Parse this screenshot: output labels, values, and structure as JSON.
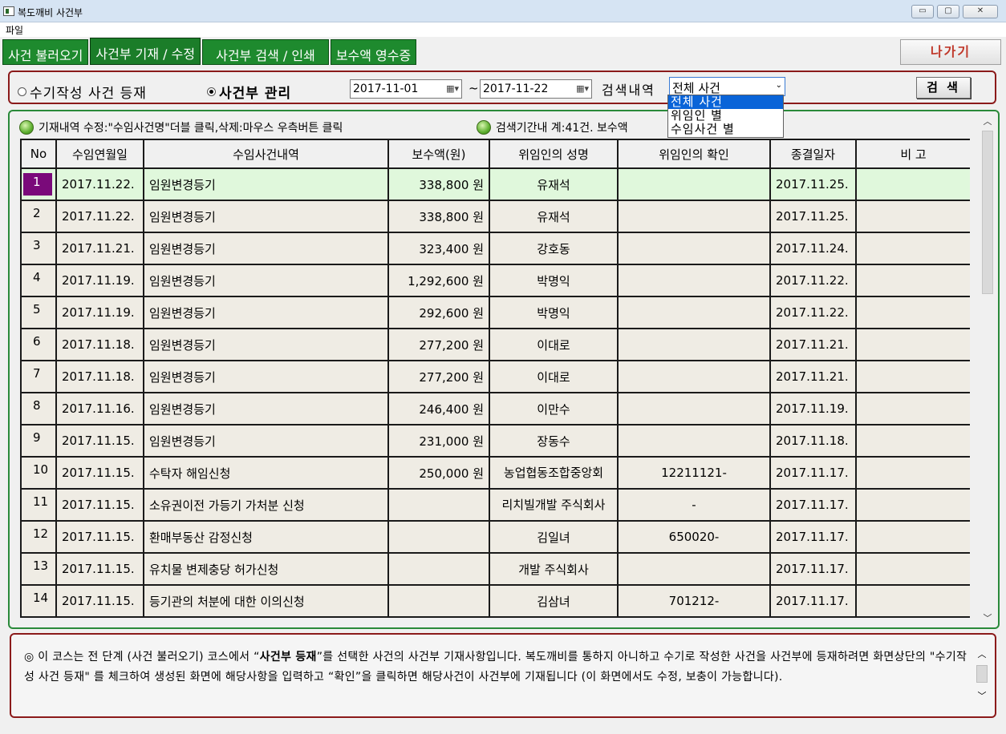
{
  "window": {
    "title": "복도깨비 사건부",
    "minimize": "▭",
    "maximize": "▢",
    "close": "✕"
  },
  "menu": {
    "file": "파일"
  },
  "tabs": [
    {
      "label": "사건 불러오기"
    },
    {
      "label": "사건부 기재 / 수정"
    },
    {
      "label": "사건부 검색 / 인쇄"
    },
    {
      "label": "보수액 영수증"
    }
  ],
  "exit_label": "나가기",
  "filter": {
    "radio_manual": "수기작성 사건 등재",
    "radio_manage": "사건부 관리",
    "date_from": "2017-11-01",
    "date_to": "2017-11-22",
    "tilde": "~",
    "search_label": "검색내역",
    "select_value": "전체 사건",
    "search_button": "검 색"
  },
  "dropdown_options": [
    "전체 사건",
    "위임인 별",
    "수임사건 별"
  ],
  "legend": {
    "edit_hint": "기재내역 수정:\"수임사건명\"더블 클릭,삭제:마우스 우측버튼 클릭",
    "summary": "검색기간내 계:41건. 보수액"
  },
  "table": {
    "headers": [
      "No",
      "수임연월일",
      "수임사건내역",
      "보수액(원)",
      "위임인의 성명",
      "위임인의 확인",
      "종결일자",
      "비  고"
    ],
    "rows": [
      [
        "1",
        "2017.11.22.",
        "임원변경등기",
        "338,800 원",
        "유재석",
        "",
        "2017.11.25.",
        ""
      ],
      [
        "2",
        "2017.11.22.",
        "임원변경등기",
        "338,800 원",
        "유재석",
        "",
        "2017.11.25.",
        ""
      ],
      [
        "3",
        "2017.11.21.",
        "임원변경등기",
        "323,400 원",
        "강호동",
        "",
        "2017.11.24.",
        ""
      ],
      [
        "4",
        "2017.11.19.",
        "임원변경등기",
        "1,292,600 원",
        "박명익",
        "",
        "2017.11.22.",
        ""
      ],
      [
        "5",
        "2017.11.19.",
        "임원변경등기",
        "292,600 원",
        "박명익",
        "",
        "2017.11.22.",
        ""
      ],
      [
        "6",
        "2017.11.18.",
        "임원변경등기",
        "277,200 원",
        "이대로",
        "",
        "2017.11.21.",
        ""
      ],
      [
        "7",
        "2017.11.18.",
        "임원변경등기",
        "277,200 원",
        "이대로",
        "",
        "2017.11.21.",
        ""
      ],
      [
        "8",
        "2017.11.16.",
        "임원변경등기",
        "246,400 원",
        "이만수",
        "",
        "2017.11.19.",
        ""
      ],
      [
        "9",
        "2017.11.15.",
        "임원변경등기",
        "231,000 원",
        "장동수",
        "",
        "2017.11.18.",
        ""
      ],
      [
        "10",
        "2017.11.15.",
        "수탁자 해임신청",
        "250,000 원",
        "농업협동조합중앙회",
        "12211121-",
        "2017.11.17.",
        ""
      ],
      [
        "11",
        "2017.11.15.",
        "소유권이전 가등기 가처분 신청",
        "",
        "리치빌개발 주식회사",
        "-",
        "2017.11.17.",
        ""
      ],
      [
        "12",
        "2017.11.15.",
        "환매부동산 감정신청",
        "",
        "김일녀",
        "650020-",
        "2017.11.17.",
        ""
      ],
      [
        "13",
        "2017.11.15.",
        "유치물 변제충당 허가신청",
        "",
        "개발 주식회사",
        "",
        "2017.11.17.",
        ""
      ],
      [
        "14",
        "2017.11.15.",
        "등기관의 처분에 대한 이의신청",
        "",
        "김삼녀",
        "701212-",
        "2017.11.17.",
        ""
      ]
    ]
  },
  "note": {
    "prefix": "◎ 이 코스는 전 단계 (사건 불러오기) 코스에서 “",
    "bold": "사건부 등재",
    "suffix": "”를 선택한 사건의 사건부 기재사항입니다. 복도깨비를 통하지 아니하고 수기로 작성한 사건을 사건부에 등재하려면 화면상단의 \"수기작성 사건 등재\" 를 체크하여 생성된 화면에 해당사항을 입력하고 “확인”을 클릭하면 해당사건이 사건부에 기재됩니다 (이 화면에서도 수정, 보충이 가능합니다)."
  }
}
